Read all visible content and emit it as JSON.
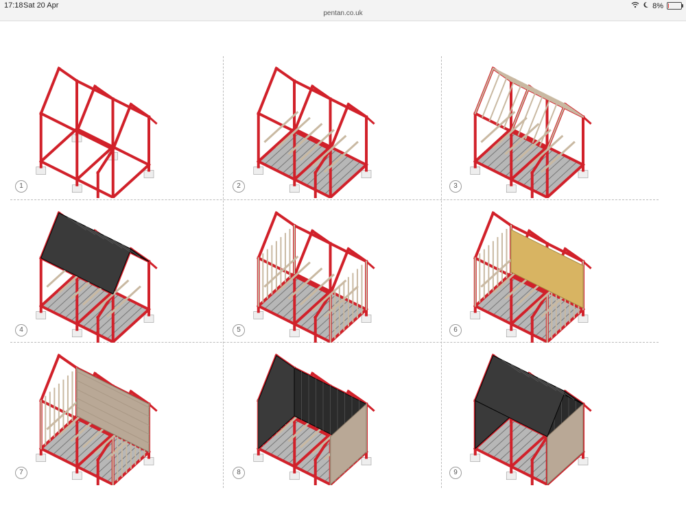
{
  "status_bar": {
    "time": "17:18",
    "date": "Sat 20 Apr",
    "url": "pentan.co.uk",
    "battery_text": "8%",
    "battery_level": 0.08
  },
  "steps": [
    {
      "number": "1"
    },
    {
      "number": "2"
    },
    {
      "number": "3"
    },
    {
      "number": "4"
    },
    {
      "number": "5"
    },
    {
      "number": "6"
    },
    {
      "number": "7"
    },
    {
      "number": "8"
    },
    {
      "number": "9"
    }
  ],
  "colors": {
    "frame": "#d1212a",
    "timber": "#c9b9a2",
    "floor": "#b7b7b7",
    "insulation": "#d8b462",
    "cladding_dark": "#2b2b2b",
    "cladding_light": "#b9a896",
    "footing": "#eeeeee"
  }
}
